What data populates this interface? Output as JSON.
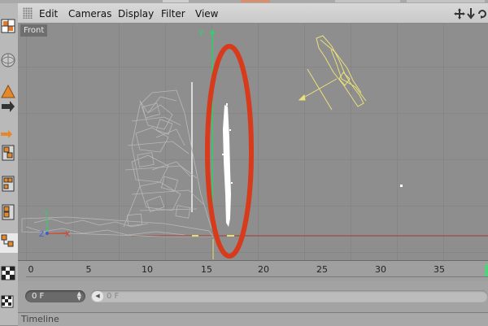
{
  "menubar": {
    "items": [
      {
        "label": "Edit"
      },
      {
        "label": "Cameras"
      },
      {
        "label": "Display"
      },
      {
        "label": "Filter"
      },
      {
        "label": "View"
      }
    ],
    "nav_icons": [
      "move-view-icon",
      "zoom-view-icon",
      "rotate-view-icon"
    ]
  },
  "viewport": {
    "label": "Front",
    "axes": {
      "y": "Y",
      "x": "X",
      "z": "Z"
    }
  },
  "timeline": {
    "ticks": [
      "0",
      "5",
      "10",
      "15",
      "20",
      "25",
      "30",
      "35"
    ],
    "frame_field_value": "0 F",
    "slider_value": "0 F",
    "label": "Timeline"
  },
  "colors": {
    "annotation_ellipse": "#d83a1c",
    "light_wire": "#ebe07a",
    "green_axis": "#2fd16c",
    "playhead": "#57d07b"
  },
  "left_toolbar": [
    "render-settings-icon",
    "sphere-object-icon",
    "cone-object-icon",
    "move-arrow-icon",
    "arrow-icon",
    "cube-array-icon",
    "cube-grid-icon",
    "cube-stack-icon",
    "object-tree-icon",
    "checker-icon",
    "checker-small-icon"
  ]
}
